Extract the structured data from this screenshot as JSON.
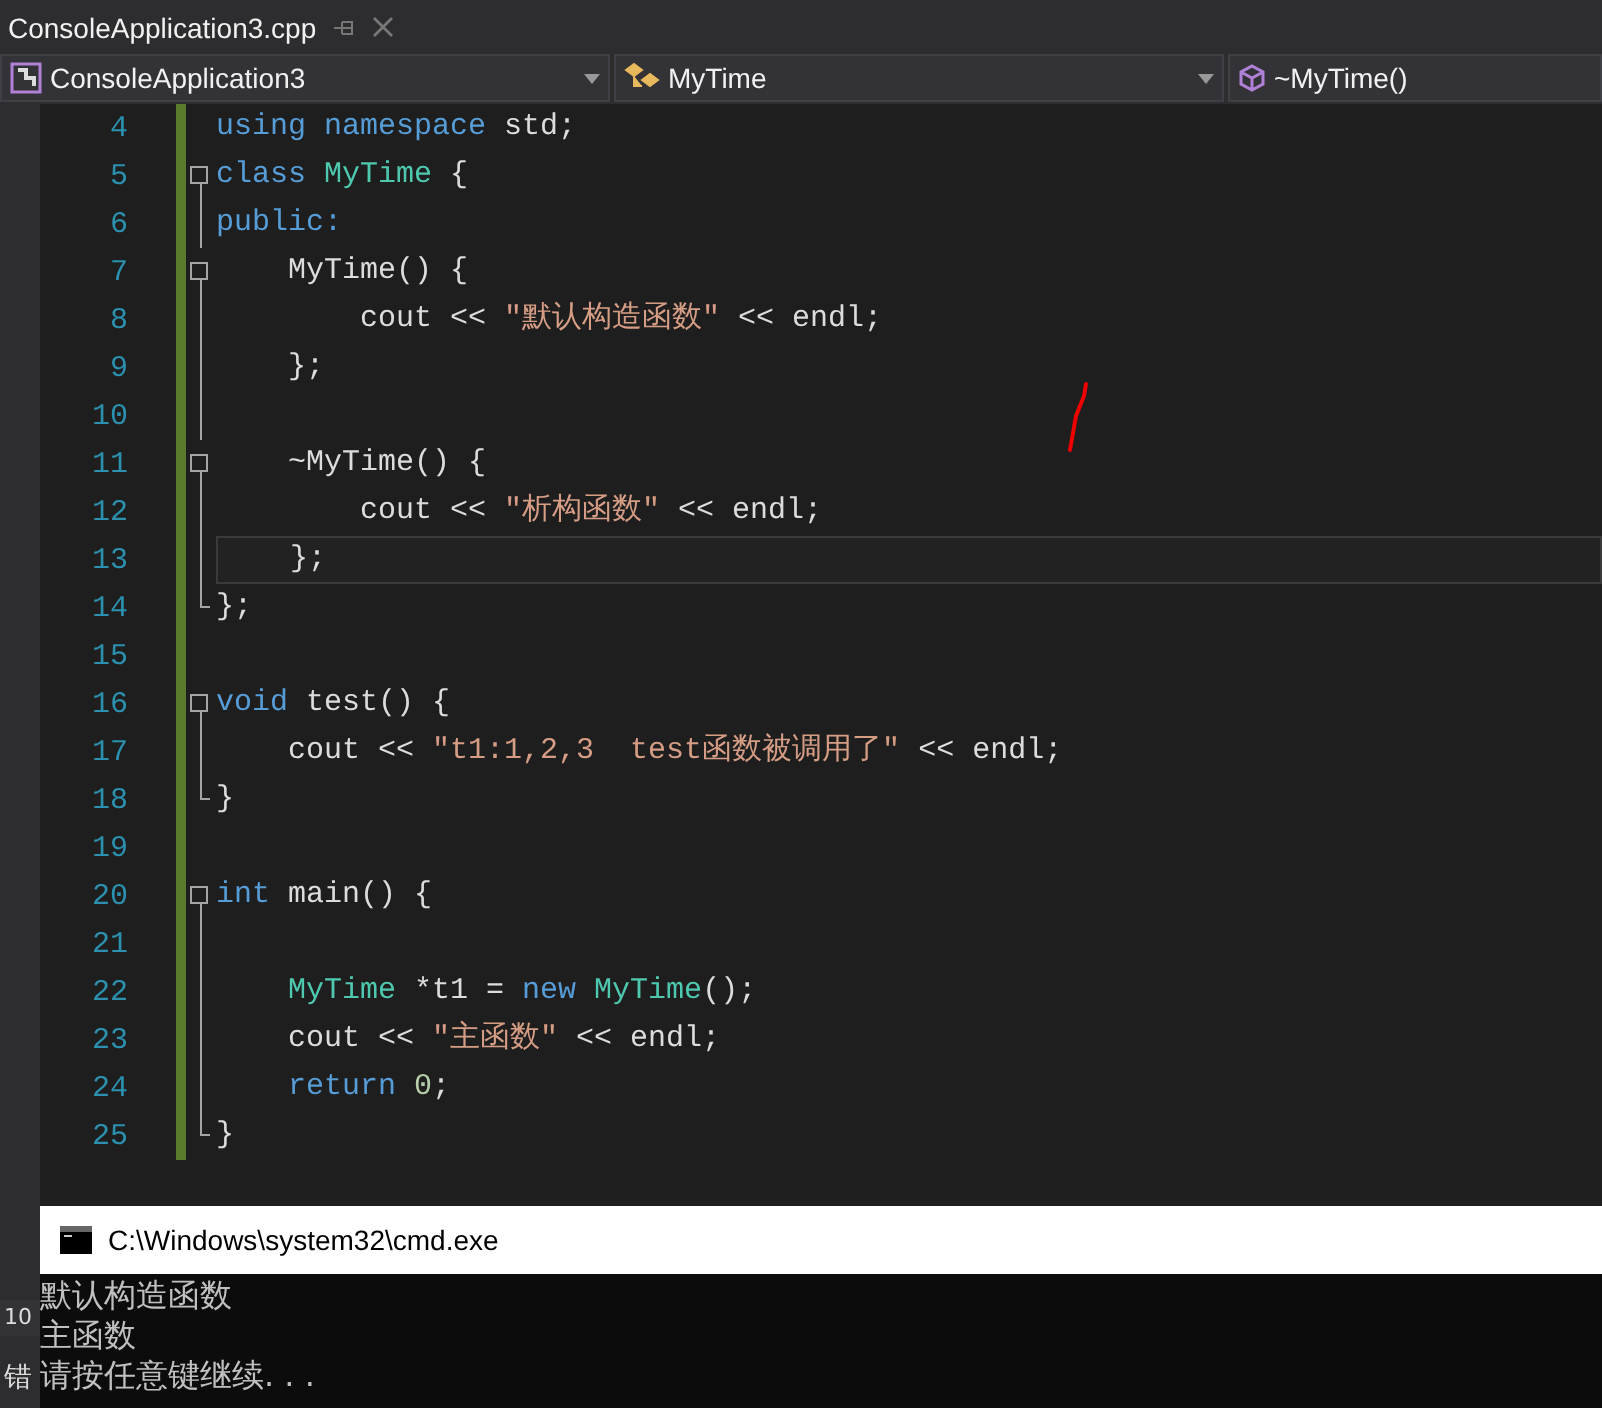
{
  "tab": {
    "title": "ConsoleApplication3.cpp"
  },
  "nav_bar": [
    {
      "kind": "project",
      "label": "ConsoleApplication3"
    },
    {
      "kind": "class",
      "label": "MyTime"
    },
    {
      "kind": "method",
      "label": "~MyTime()"
    }
  ],
  "code_lines": [
    {
      "number": "4",
      "kind": "plain",
      "current": false,
      "tokens": [
        {
          "kind": "keyword",
          "text": "using namespace"
        },
        {
          "kind": "plain",
          "text": " std;"
        }
      ]
    },
    {
      "number": "5",
      "kind": "fold-start",
      "current": false,
      "tokens": [
        {
          "kind": "keyword",
          "text": "class"
        },
        {
          "kind": "type",
          "text": " MyTime"
        },
        {
          "kind": "plain",
          "text": " {"
        }
      ]
    },
    {
      "number": "6",
      "kind": "fold-body",
      "current": false,
      "tokens": [
        {
          "kind": "keyword",
          "text": "public:"
        }
      ]
    },
    {
      "number": "7",
      "kind": "fold-start",
      "current": false,
      "tokens": [
        {
          "kind": "plain",
          "text": "    MyTime() {"
        }
      ]
    },
    {
      "number": "8",
      "kind": "fold-body",
      "current": false,
      "tokens": [
        {
          "kind": "plain",
          "text": "        cout << "
        },
        {
          "kind": "string",
          "text": "″默认构造函数″"
        },
        {
          "kind": "plain",
          "text": " << endl;"
        }
      ]
    },
    {
      "number": "9",
      "kind": "fold-body",
      "current": false,
      "tokens": [
        {
          "kind": "plain",
          "text": "    };"
        }
      ]
    },
    {
      "number": "10",
      "kind": "fold-body",
      "current": false
    },
    {
      "number": "11",
      "kind": "fold-start",
      "current": false,
      "tokens": [
        {
          "kind": "plain",
          "text": "    ~MyTime() {"
        }
      ]
    },
    {
      "number": "12",
      "kind": "fold-body",
      "current": false,
      "tokens": [
        {
          "kind": "plain",
          "text": "        cout << "
        },
        {
          "kind": "string",
          "text": "″析构函数″"
        },
        {
          "kind": "plain",
          "text": " << endl;"
        }
      ]
    },
    {
      "number": "13",
      "kind": "fold-body",
      "current": true,
      "tokens": [
        {
          "kind": "plain",
          "text": "    };"
        }
      ]
    },
    {
      "number": "14",
      "kind": "fold-end",
      "current": false,
      "tokens": [
        {
          "kind": "plain",
          "text": "};"
        }
      ]
    },
    {
      "number": "15",
      "kind": "plain",
      "current": false
    },
    {
      "number": "16",
      "kind": "fold-start",
      "current": false,
      "tokens": [
        {
          "kind": "keyword",
          "text": "void"
        },
        {
          "kind": "plain",
          "text": " test() {"
        }
      ]
    },
    {
      "number": "17",
      "kind": "fold-body",
      "current": false,
      "tokens": [
        {
          "kind": "plain",
          "text": "    cout << "
        },
        {
          "kind": "string",
          "text": "″t1:1,2,3  test函数被调用了″"
        },
        {
          "kind": "plain",
          "text": " << endl;"
        }
      ]
    },
    {
      "number": "18",
      "kind": "fold-end",
      "current": false,
      "tokens": [
        {
          "kind": "plain",
          "text": "}"
        }
      ]
    },
    {
      "number": "19",
      "kind": "plain",
      "current": false
    },
    {
      "number": "20",
      "kind": "fold-start",
      "current": false,
      "tokens": [
        {
          "kind": "keyword",
          "text": "int"
        },
        {
          "kind": "plain",
          "text": " main() {"
        }
      ]
    },
    {
      "number": "21",
      "kind": "fold-body",
      "current": false
    },
    {
      "number": "22",
      "kind": "fold-body",
      "current": false,
      "tokens": [
        {
          "kind": "type",
          "text": "    MyTime"
        },
        {
          "kind": "plain",
          "text": " *t1 ="
        },
        {
          "kind": "keyword",
          "text": " new"
        },
        {
          "kind": "type",
          "text": " MyTime"
        },
        {
          "kind": "plain",
          "text": "();"
        }
      ]
    },
    {
      "number": "23",
      "kind": "fold-body",
      "current": false,
      "tokens": [
        {
          "kind": "plain",
          "text": "    cout << "
        },
        {
          "kind": "string",
          "text": "″主函数″"
        },
        {
          "kind": "plain",
          "text": " << endl;"
        }
      ]
    },
    {
      "number": "24",
      "kind": "fold-body",
      "current": false,
      "tokens": [
        {
          "kind": "keyword",
          "text": "    return"
        },
        {
          "kind": "number",
          "text": " 0"
        },
        {
          "kind": "plain",
          "text": ";"
        }
      ]
    },
    {
      "number": "25",
      "kind": "fold-end",
      "current": false,
      "tokens": [
        {
          "kind": "plain",
          "text": "}"
        }
      ]
    }
  ],
  "side_panel": {
    "zoom_level": "10",
    "label": "错"
  },
  "console": {
    "title": "C:\\Windows\\system32\\cmd.exe",
    "lines": [
      "默认构造函数",
      "主函数",
      "请按任意键继续. . ."
    ]
  }
}
